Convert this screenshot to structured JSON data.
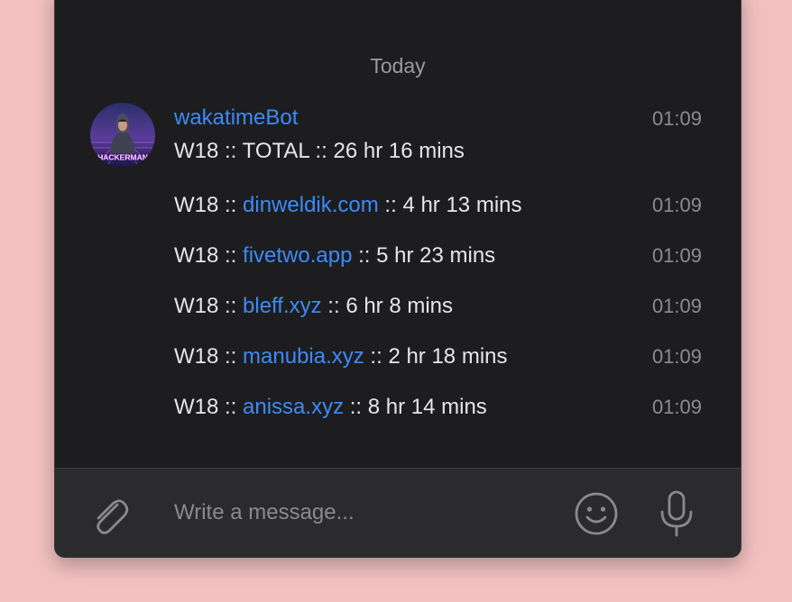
{
  "chat": {
    "date_separator": "Today",
    "sender": "wakatimeBot",
    "messages": [
      {
        "text": "W18 :: TOTAL :: 26 hr 16 mins",
        "time": "01:09"
      },
      {
        "prefix": "W18 :: ",
        "link": "dinweldik.com",
        "suffix": " :: 4 hr 13 mins",
        "time": "01:09"
      },
      {
        "prefix": "W18 :: ",
        "link": "fivetwo.app",
        "suffix": " :: 5 hr 23 mins",
        "time": "01:09"
      },
      {
        "prefix": "W18 :: ",
        "link": "bleff.xyz",
        "suffix": " :: 6 hr 8 mins",
        "time": "01:09"
      },
      {
        "prefix": "W18 :: ",
        "link": "manubia.xyz",
        "suffix": " :: 2 hr 18 mins",
        "time": "01:09"
      },
      {
        "prefix": "W18 :: ",
        "link": "anissa.xyz",
        "suffix": " :: 8 hr 14 mins",
        "time": "01:09"
      }
    ]
  },
  "avatar": {
    "caption": "HACKERMAN"
  },
  "composer": {
    "placeholder": "Write a message...",
    "attach_icon": "paperclip-icon",
    "emoji_icon": "smiley-icon",
    "mic_icon": "microphone-icon"
  },
  "colors": {
    "page_background": "#f2c0c0",
    "window_background": "#1d1d1f",
    "composer_background": "#2b2b2d",
    "accent": "#3d8af7",
    "text": "#e6e6e8",
    "muted": "#8c8c90"
  }
}
